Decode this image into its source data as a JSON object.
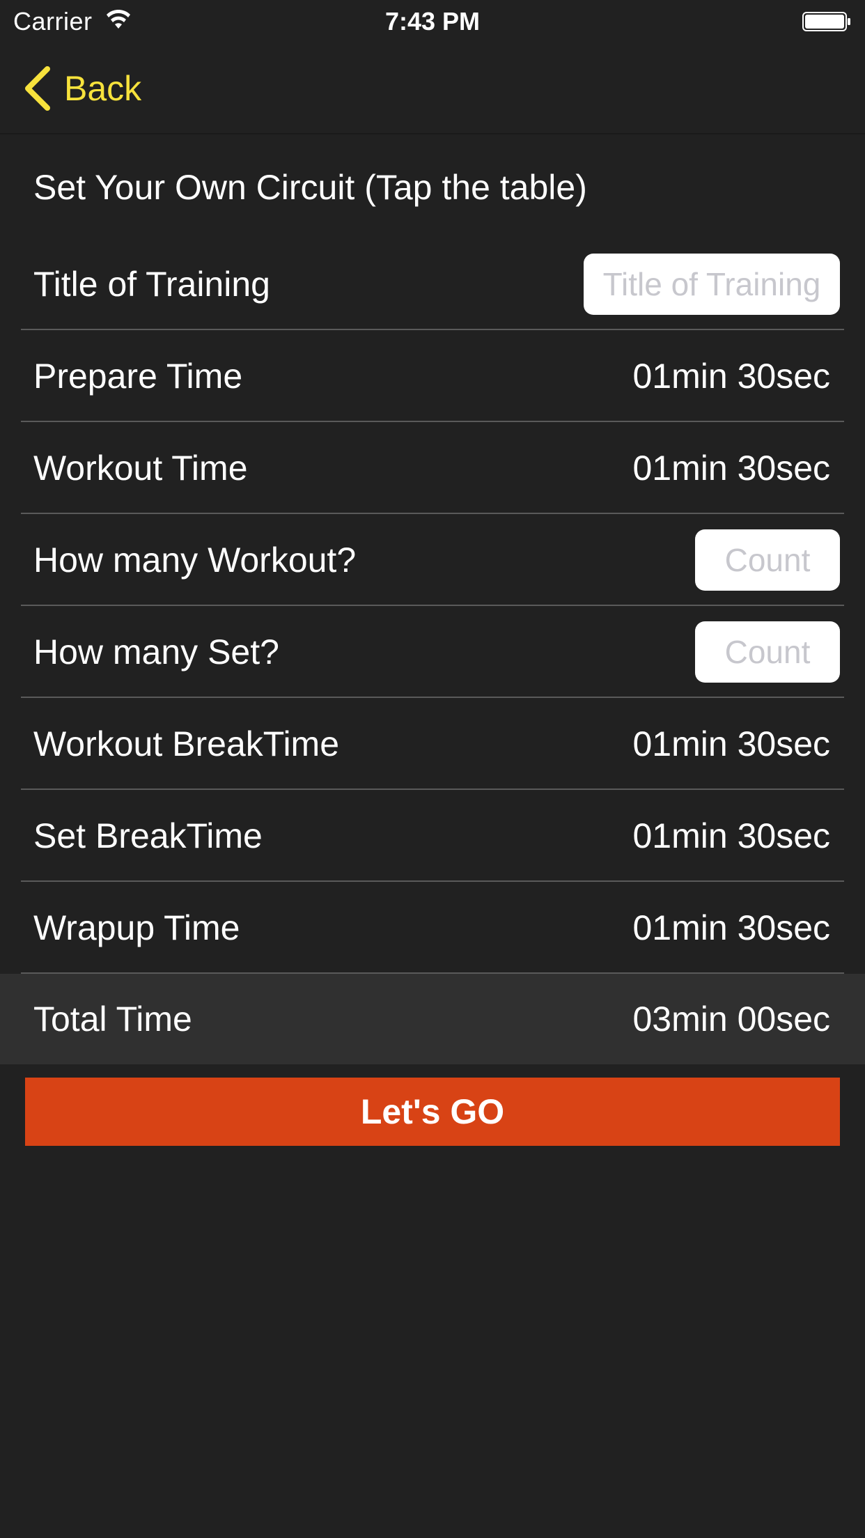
{
  "status_bar": {
    "carrier": "Carrier",
    "time": "7:43 PM",
    "wifi_icon": "wifi-icon",
    "battery_icon": "battery-icon"
  },
  "nav": {
    "back_label": "Back",
    "back_icon": "chevron-left-icon",
    "accent_color": "#f7e23c"
  },
  "header": {
    "title": "Set Your Own Circuit (Tap the table)"
  },
  "rows": [
    {
      "label": "Title of Training",
      "placeholder": "Title of Training"
    },
    {
      "label": "Prepare Time",
      "value": "01min 30sec"
    },
    {
      "label": "Workout Time",
      "value": "01min 30sec"
    },
    {
      "label": "How many Workout?",
      "placeholder": "Count"
    },
    {
      "label": "How many Set?",
      "placeholder": "Count"
    },
    {
      "label": "Workout BreakTime",
      "value": "01min 30sec"
    },
    {
      "label": "Set BreakTime",
      "value": "01min 30sec"
    },
    {
      "label": "Wrapup Time",
      "value": "01min 30sec"
    }
  ],
  "total": {
    "label": "Total Time",
    "value": "03min 00sec"
  },
  "go_button": {
    "label": "Let's GO",
    "color": "#d84315"
  },
  "colors": {
    "background": "#212121",
    "total_row_background": "#303030",
    "divider": "#5a5a5a"
  }
}
